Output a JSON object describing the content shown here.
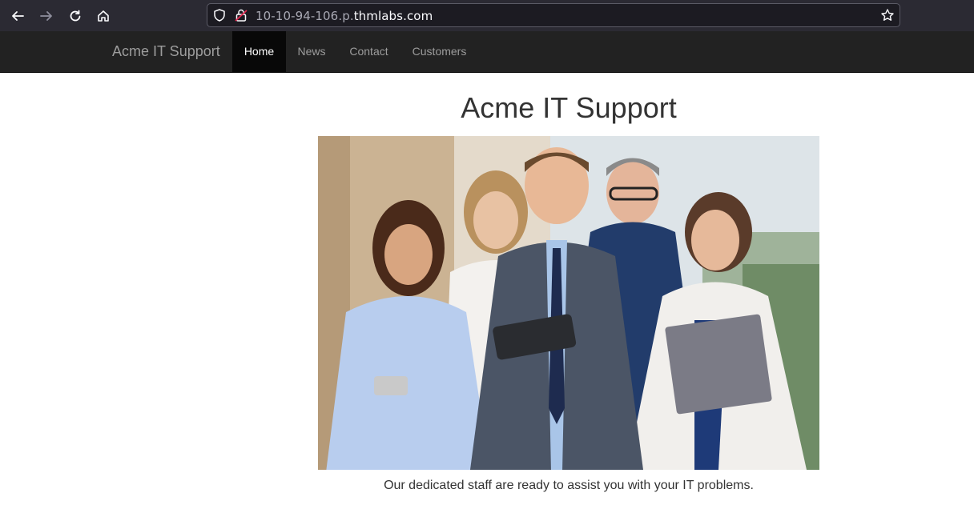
{
  "browser": {
    "url_prefix": "10-10-94-106.p.",
    "url_domain": "thmlabs.com"
  },
  "navbar": {
    "brand": "Acme IT Support",
    "items": [
      {
        "label": "Home",
        "active": true
      },
      {
        "label": "News",
        "active": false
      },
      {
        "label": "Contact",
        "active": false
      },
      {
        "label": "Customers",
        "active": false
      }
    ]
  },
  "main": {
    "title": "Acme IT Support",
    "caption": "Our dedicated staff are ready to assist you with your IT problems."
  },
  "colors": {
    "navbar_bg": "#222222",
    "navbar_active_bg": "#080808",
    "chrome_bg": "#2b2a33",
    "text": "#333333"
  }
}
